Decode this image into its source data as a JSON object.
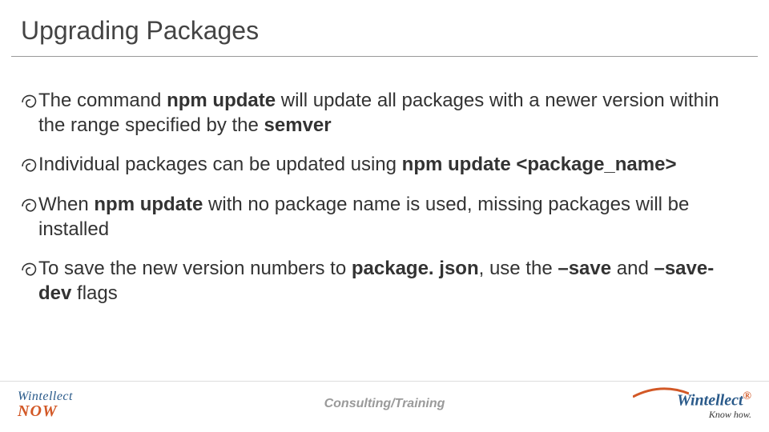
{
  "title": "Upgrading Packages",
  "bullets": [
    {
      "html": "The command <b>npm update</b> will update all packages with a newer version within the range specified by the <b>semver</b>"
    },
    {
      "html": "Individual packages can be updated using <b>npm update &lt;package_name&gt;</b>"
    },
    {
      "html": "When <b>npm update</b> with no package name is used, missing packages will be installed"
    },
    {
      "html": "To save the new version numbers to <b>package. json</b>, use the <b>–save</b> and <b>–save-dev</b> flags"
    }
  ],
  "footer": {
    "center_text": "Consulting/Training",
    "left_logo": {
      "line1": "Wintellect",
      "line2": "NOW"
    },
    "right_logo": {
      "line1": "Wintellect",
      "reg": "®",
      "line2": "Know how."
    }
  },
  "colors": {
    "accent_orange": "#d25826",
    "accent_blue": "#2a5a8a"
  }
}
